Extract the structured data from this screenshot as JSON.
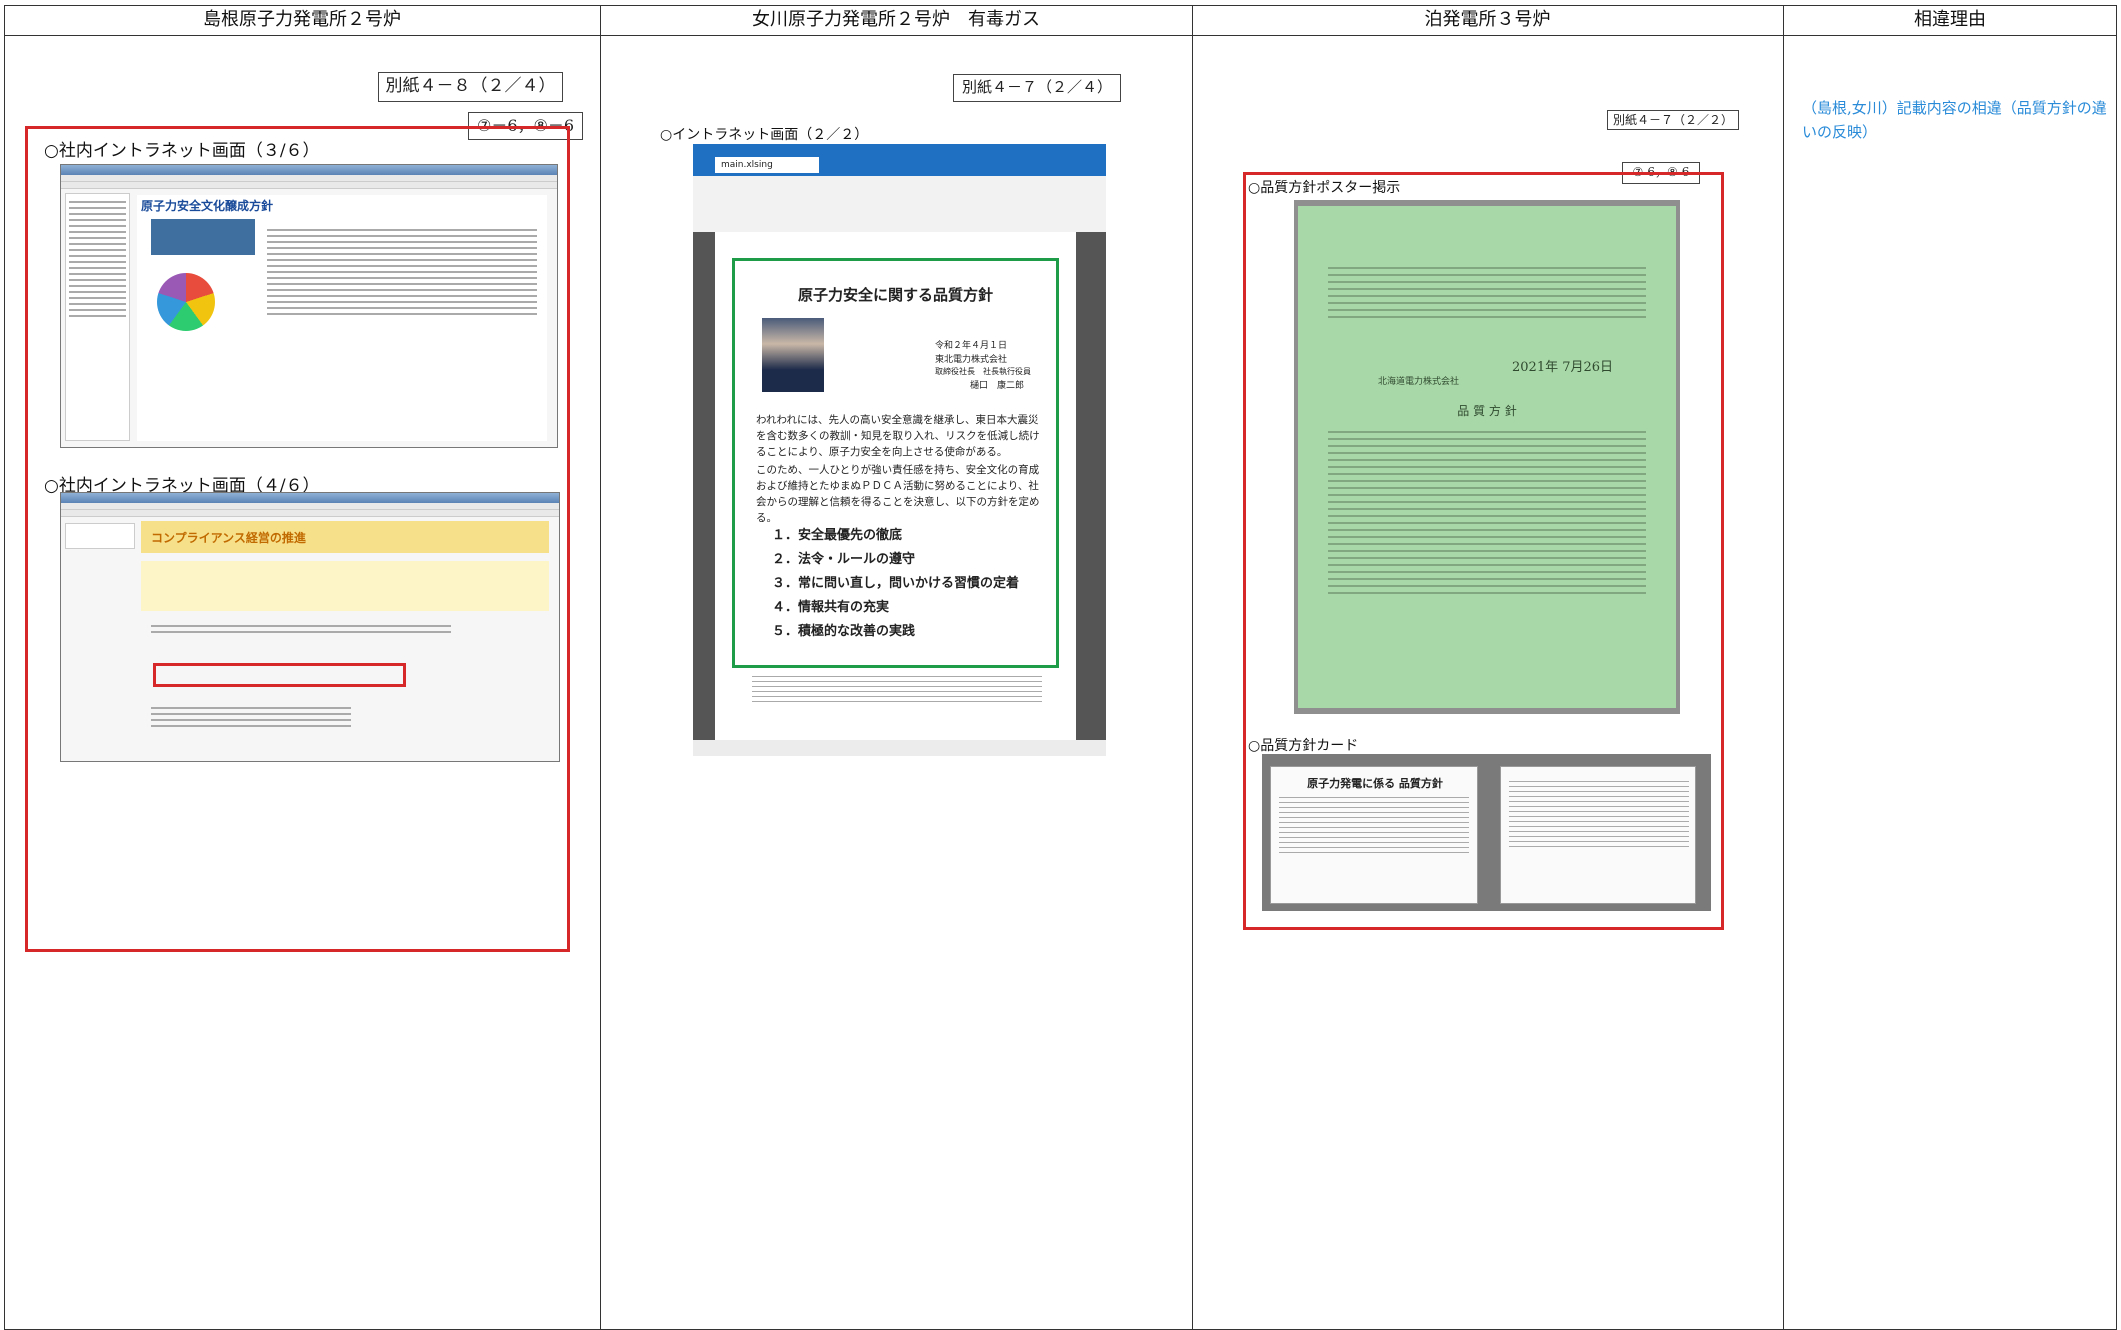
{
  "columns": {
    "col1": "島根原子力発電所２号炉",
    "col2": "女川原子力発電所２号炉　有毒ガス",
    "col3": "泊発電所３号炉",
    "col4": "相違理由"
  },
  "shimane": {
    "appendix": "別紙４－８（２／４）",
    "tag": "⑦－6，⑧－6",
    "heading1": "○社内イントラネット画面（３/６）",
    "heading2": "○社内イントラネット画面（４/６）",
    "page1_title": "原子力安全文化醸成方針",
    "page2_title": "コンプライアンス経営の推進"
  },
  "onagawa": {
    "appendix": "別紙４－７（２／４）",
    "heading": "○イントラネット画面（２／２）",
    "tab_label": "main.xlsing",
    "policy_title": "原子力安全に関する品質方針",
    "date": "令和２年４月１日",
    "company": "東北電力株式会社",
    "signer_title": "取締役社長　社長執行役員",
    "signer_name": "樋口　康二郎",
    "para1": "われわれには、先人の高い安全意識を継承し、東日本大震災を含む数多くの教訓・知見を取り入れ、リスクを低減し続けることにより、原子力安全を向上させる使命がある。",
    "para2": "このため、一人ひとりが強い責任感を持ち、安全文化の育成および維持とたゆまぬＰＤＣＡ活動に努めることにより、社会からの理解と信頼を得ることを決意し、以下の方針を定める。",
    "items": [
      "１．安全最優先の徹底",
      "２．法令・ルールの遵守",
      "３．常に問い直し，問いかける習慣の定着",
      "４．情報共有の充実",
      "５．積極的な改善の実践"
    ]
  },
  "tomari": {
    "appendix": "別紙４－７（２／２）",
    "tag": "⑦-6，⑧-6",
    "heading1": "○品質方針ポスター掲示",
    "heading2": "○品質方針カード",
    "poster_date": "2021年 7月26日",
    "poster_company": "北海道電力株式会社",
    "poster_heading": "品 質 方 針",
    "card_title": "原子力発電に係る 品質方針"
  },
  "reason": {
    "text": "（島根,女川）記載内容の相違（品質方針の違いの反映）"
  }
}
